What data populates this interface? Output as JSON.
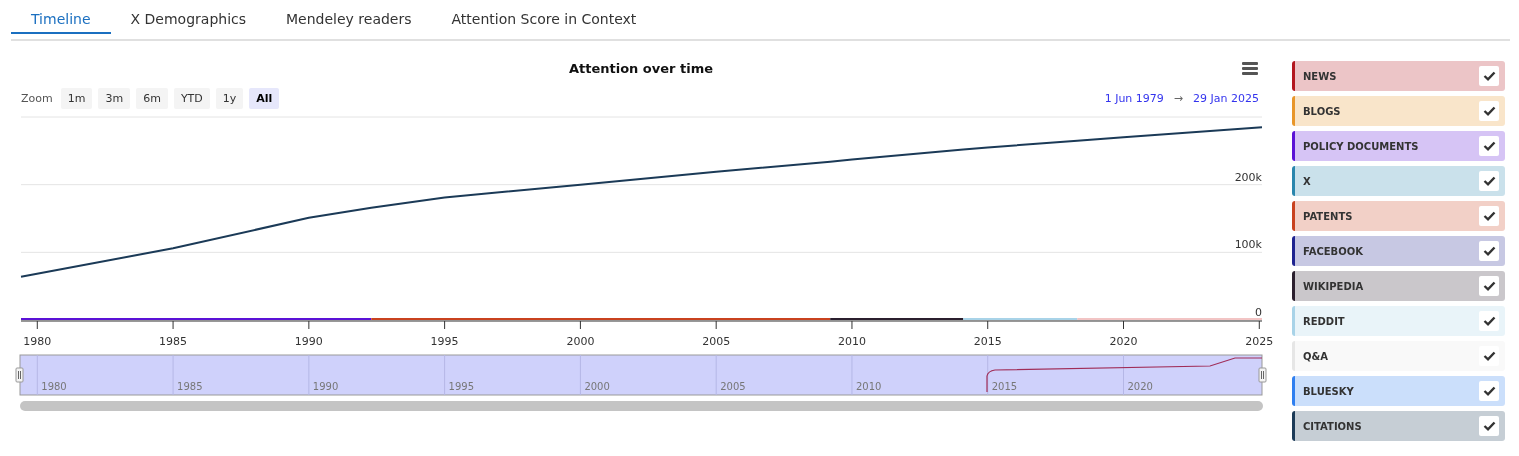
{
  "tabs": [
    {
      "label": "Timeline",
      "selected": true
    },
    {
      "label": "X Demographics",
      "selected": false
    },
    {
      "label": "Mendeley readers",
      "selected": false
    },
    {
      "label": "Attention Score in Context",
      "selected": false
    }
  ],
  "chart": {
    "title": "Attention over time",
    "zoom_label": "Zoom",
    "zoom_buttons": [
      {
        "label": "1m",
        "selected": false
      },
      {
        "label": "3m",
        "selected": false
      },
      {
        "label": "6m",
        "selected": false
      },
      {
        "label": "YTD",
        "selected": false
      },
      {
        "label": "1y",
        "selected": false
      },
      {
        "label": "All",
        "selected": true
      }
    ],
    "range_from": "1 Jun 1979",
    "range_arrow": "→",
    "range_to": "29 Jan 2025",
    "chart_data": {
      "type": "line",
      "x": [
        1979.4,
        1985,
        1990,
        1992.3,
        1995,
        2000,
        2005,
        2009.2,
        2010,
        2014.1,
        2015,
        2018.3,
        2020,
        2025.1
      ],
      "series": [
        {
          "color": "#1b3a57",
          "values": [
            64000,
            106000,
            151000,
            166000,
            181000,
            200000,
            219000,
            234000,
            237000,
            252000,
            255000,
            265000,
            270000,
            285000
          ]
        },
        {
          "color": "#5b12d6",
          "values": [
            0,
            0,
            0,
            0,
            null,
            null,
            null,
            null,
            null,
            null,
            null,
            null,
            null,
            null
          ]
        },
        {
          "color": "#c9421f",
          "values": [
            null,
            null,
            null,
            0,
            0,
            0,
            0,
            0,
            null,
            null,
            null,
            null,
            null,
            null
          ]
        },
        {
          "color": "#2b1f2e",
          "values": [
            null,
            null,
            null,
            null,
            null,
            null,
            null,
            0,
            0,
            0,
            null,
            null,
            null,
            null
          ]
        },
        {
          "color": "#a8d3e8",
          "values": [
            null,
            null,
            null,
            null,
            null,
            null,
            null,
            null,
            null,
            0,
            0,
            0,
            null,
            null
          ]
        },
        {
          "color": "#f2c4c4",
          "values": [
            null,
            null,
            null,
            null,
            null,
            null,
            null,
            null,
            null,
            null,
            null,
            0,
            0,
            0
          ]
        }
      ],
      "xlim": [
        1979.4,
        2025.1
      ],
      "ylim": [
        0,
        300000
      ],
      "xticks": [
        1980,
        1985,
        1990,
        1995,
        2000,
        2005,
        2010,
        2015,
        2020,
        2025
      ],
      "yticks": [
        {
          "value": 0,
          "label": "0"
        },
        {
          "value": 100000,
          "label": "100k"
        },
        {
          "value": 200000,
          "label": "200k"
        }
      ]
    },
    "navigator_labels": [
      "1980",
      "1985",
      "1990",
      "1995",
      "2000",
      "2005",
      "2010",
      "2015",
      "2020"
    ]
  },
  "legend": [
    {
      "label": "NEWS",
      "color": "#b3171f",
      "checked": true
    },
    {
      "label": "BLOGS",
      "color": "#e8962a",
      "checked": true
    },
    {
      "label": "POLICY DOCUMENTS",
      "color": "#5b12d6",
      "checked": true
    },
    {
      "label": "X",
      "color": "#2a86ad",
      "checked": true
    },
    {
      "label": "PATENTS",
      "color": "#c9421f",
      "checked": true
    },
    {
      "label": "FACEBOOK",
      "color": "#1e2390",
      "checked": true
    },
    {
      "label": "WIKIPEDIA",
      "color": "#2b1f2e",
      "checked": true
    },
    {
      "label": "REDDIT",
      "color": "#a8d3e8",
      "checked": true
    },
    {
      "label": "Q&A",
      "color": "#e6e6e6",
      "checked": true
    },
    {
      "label": "BLUESKY",
      "color": "#2f7ff0",
      "checked": true
    },
    {
      "label": "CITATIONS",
      "color": "#1b3a57",
      "checked": true
    }
  ]
}
